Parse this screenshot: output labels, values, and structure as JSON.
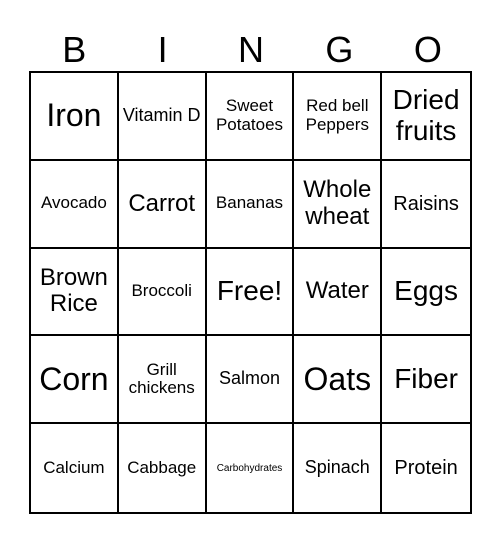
{
  "header": {
    "letters": [
      "B",
      "I",
      "N",
      "G",
      "O"
    ]
  },
  "board": {
    "rows": [
      [
        "Iron",
        "Vitamin D",
        "Sweet Potatoes",
        "Red bell Peppers",
        "Dried fruits"
      ],
      [
        "Avocado",
        "Carrot",
        "Bananas",
        "Whole wheat",
        "Raisins"
      ],
      [
        "Brown Rice",
        "Broccoli",
        "Free!",
        "Water",
        "Eggs"
      ],
      [
        "Corn",
        "Grill chickens",
        "Salmon",
        "Oats",
        "Fiber"
      ],
      [
        "Calcium",
        "Cabbage",
        "Carbohydrates",
        "Spinach",
        "Protein"
      ]
    ],
    "free_space": "Free!"
  }
}
